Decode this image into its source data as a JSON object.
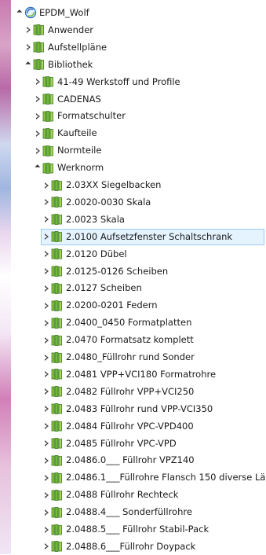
{
  "tree": {
    "root": {
      "label": "EPDM_Wolf",
      "icon": "vault-root-icon"
    },
    "level1": [
      {
        "label": "Anwender",
        "state": "collapsed"
      },
      {
        "label": "Aufstellpläne",
        "state": "collapsed"
      },
      {
        "label": "Bibliothek",
        "state": "expanded"
      }
    ],
    "bibliothek": [
      {
        "label": "41-49 Werkstoff und Profile",
        "state": "collapsed"
      },
      {
        "label": "CADENAS",
        "state": "collapsed"
      },
      {
        "label": "Formatschulter",
        "state": "collapsed"
      },
      {
        "label": "Kaufteile",
        "state": "collapsed"
      },
      {
        "label": "Normteile",
        "state": "collapsed"
      },
      {
        "label": "Werknorm",
        "state": "expanded"
      }
    ],
    "werknorm": [
      {
        "label": "2.03XX Siegelbacken"
      },
      {
        "label": "2.0020-0030 Skala"
      },
      {
        "label": "2.0023 Skala"
      },
      {
        "label": "2.0100 Aufsetzfenster Schaltschrank",
        "selected": true
      },
      {
        "label": "2.0120 Dübel"
      },
      {
        "label": "2.0125-0126 Scheiben"
      },
      {
        "label": "2.0127 Scheiben"
      },
      {
        "label": "2.0200-0201 Federn"
      },
      {
        "label": "2.0400_0450 Formatplatten"
      },
      {
        "label": "2.0470 Formatsatz komplett"
      },
      {
        "label": "2.0480_Füllrohr rund Sonder"
      },
      {
        "label": "2.0481 VPP+VCI180 Formatrohre"
      },
      {
        "label": "2.0482 Füllrohr VPP+VCI250"
      },
      {
        "label": "2.0483 Füllrohr rund VPP-VCI350"
      },
      {
        "label": "2.0484 Füllrohr VPC-VPD400"
      },
      {
        "label": "2.0485 Füllrohr VPC-VPD"
      },
      {
        "label": "2.0486.0___ Füllrohr VPZ140"
      },
      {
        "label": "2.0486.1___Füllrohre Flansch 150 diverse Läng"
      },
      {
        "label": "2.0488 Füllrohr Rechteck"
      },
      {
        "label": "2.0488.4___ Sonderfüllrohre"
      },
      {
        "label": "2.0488.5___ Füllrohr Stabil-Pack"
      },
      {
        "label": "2.0488.6___Füllrohr Doypack"
      }
    ],
    "colors": {
      "selection_fill": "#e5f3ff",
      "selection_border": "#9ccaf7",
      "folder_green": "#7bc043",
      "folder_dark": "#3d7a1e"
    }
  }
}
